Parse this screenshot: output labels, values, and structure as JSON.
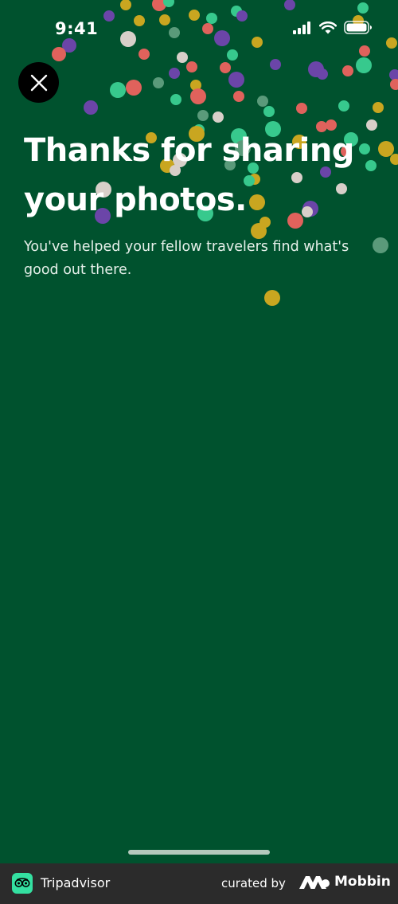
{
  "status_bar": {
    "time": "9:41",
    "icons": [
      "cellular-signal-icon",
      "wifi-icon",
      "battery-icon"
    ]
  },
  "close_button": {
    "icon": "close-icon"
  },
  "content": {
    "title_line1": "Thanks for sharing",
    "title_line2": "your photos.",
    "subtitle_line1": "You've helped your fellow travelers find what's",
    "subtitle_line2": "good out there."
  },
  "footer": {
    "app_name": "Tripadvisor",
    "curated_by": "curated by",
    "brand": "Mobbin"
  },
  "colors": {
    "background": "#00522e",
    "confetti": [
      "#e0625c",
      "#37c98d",
      "#c9a620",
      "#6b45a8",
      "#d8cfc9",
      "#5a9a7a"
    ]
  }
}
